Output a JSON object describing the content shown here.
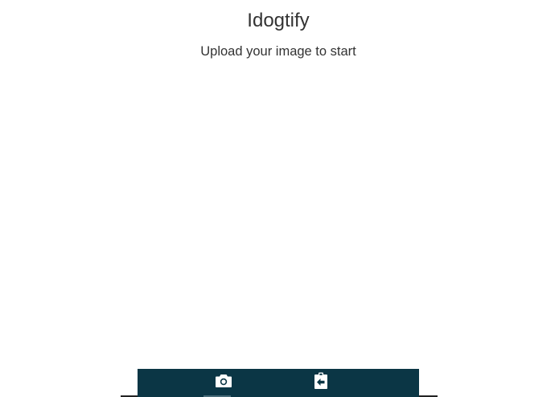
{
  "app": {
    "title": "Idogtify",
    "subtitle": "Upload your image to start"
  },
  "toolbar": {
    "items": [
      {
        "icon": "camera-icon",
        "action": "take-photo"
      },
      {
        "icon": "clipboard-paste-icon",
        "action": "upload-image"
      }
    ],
    "background_color": "#0b3645",
    "icon_color": "#ffffff"
  }
}
